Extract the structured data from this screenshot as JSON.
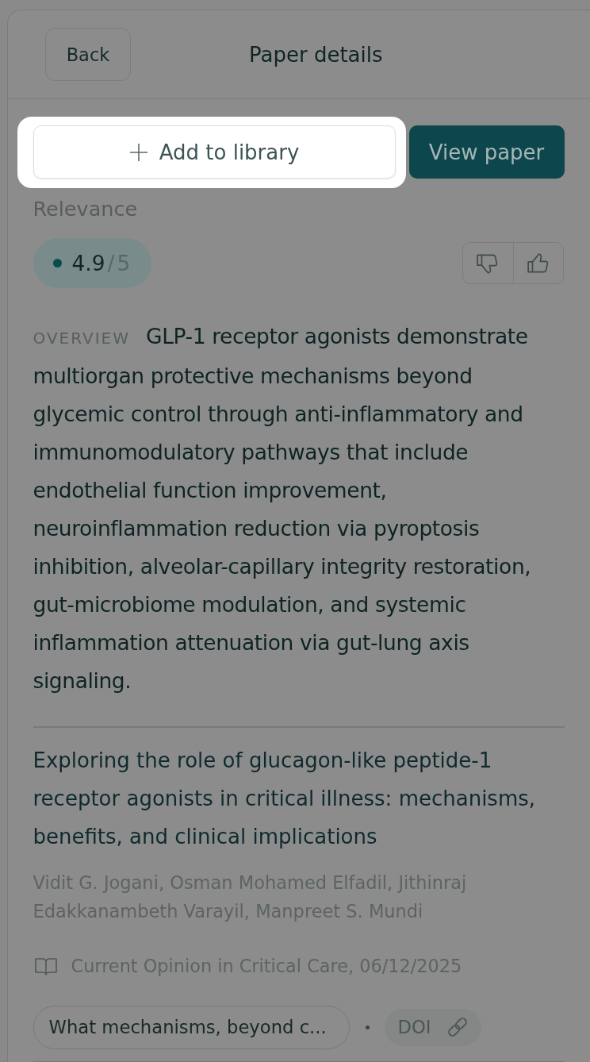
{
  "header": {
    "back_button": "Back",
    "title": "Paper details"
  },
  "actions": {
    "add_to_library": {
      "label": "Add to library",
      "highlighted": true
    },
    "view_paper": {
      "label": "View paper"
    }
  },
  "relevance": {
    "label": "Relevance",
    "score": "4.9",
    "scale": "/5"
  },
  "overview": {
    "label": "OVERVIEW",
    "text": "GLP-1 receptor agonists demonstrate multiorgan protective mechanisms beyond glycemic control through anti-inflammatory and immunomodulatory pathways that include endothelial function improvement, neuroinflammation reduction via pyroptosis inhibition, alveolar-capillary integrity restoration, gut-microbiome modulation, and systemic inflammation attenuation via gut-lung axis signaling."
  },
  "paper": {
    "title": "Exploring the role of glucagon-like peptide-1 receptor agonists in critical illness: mechanisms, benefits, and clinical implications",
    "authors": "Vidit G. Jogani, Osman Mohamed Elfadil, Jithinraj Edakkanambeth Varayil, Manpreet S. Mundi",
    "source": "Current Opinion in Critical Care, 06/12/2025"
  },
  "links": {
    "question": "What mechanisms, beyond c...",
    "doi": "DOI"
  }
}
